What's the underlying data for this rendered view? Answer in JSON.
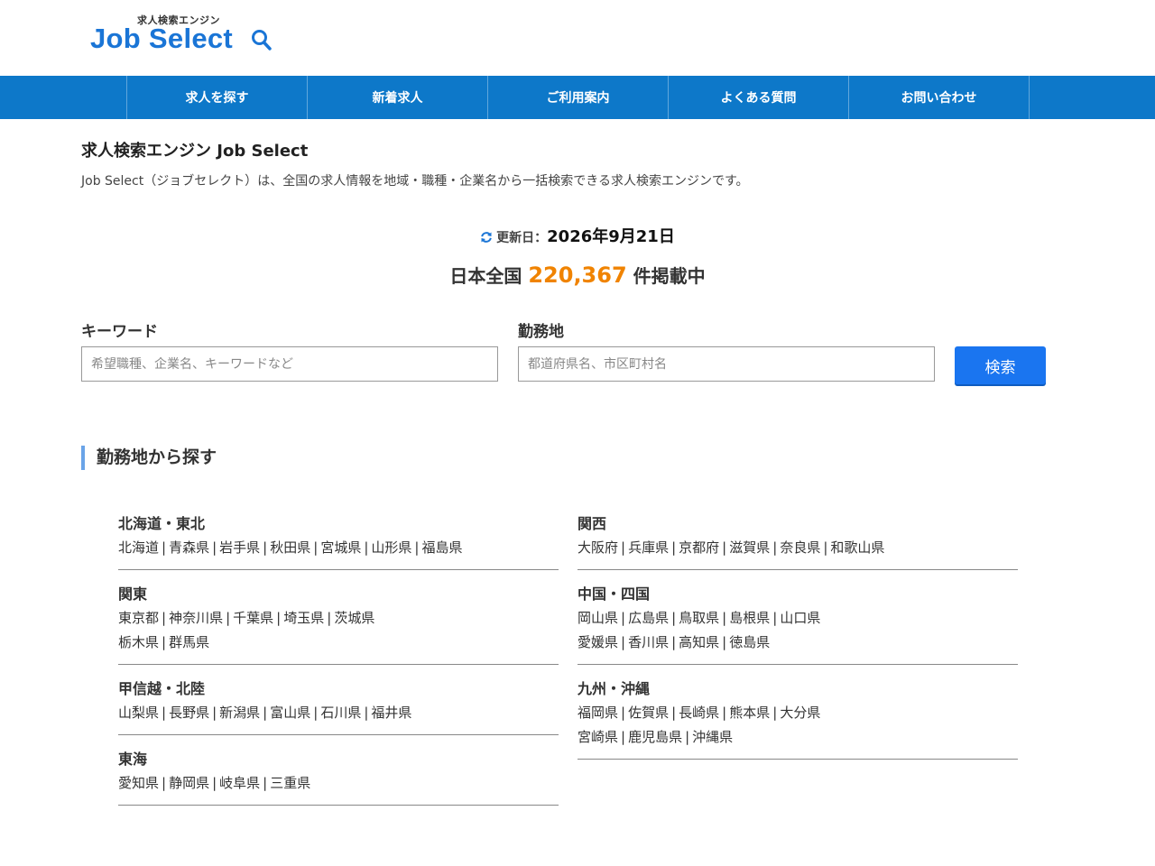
{
  "logo": {
    "subtitle": "求人検索エンジン",
    "name": "Job Select"
  },
  "nav": [
    {
      "label": "求人を探す"
    },
    {
      "label": "新着求人"
    },
    {
      "label": "ご利用案内"
    },
    {
      "label": "よくある質問"
    },
    {
      "label": "お問い合わせ"
    }
  ],
  "site": {
    "title": "求人検索エンジン Job Select",
    "description": "Job Select（ジョブセレクト）は、全国の求人情報を地域・職種・企業名から一括検索できる求人検索エンジンです。"
  },
  "updated": {
    "label": "更新日：",
    "date": "2026年9月21日",
    "icon": "refresh-icon"
  },
  "count": {
    "prefix": "日本全国",
    "number": "220,367",
    "suffix": "件掲載中"
  },
  "search": {
    "keyword_label": "キーワード",
    "keyword_placeholder": "希望職種、企業名、キーワードなど",
    "keyword_value": "",
    "location_label": "勤務地",
    "location_placeholder": "都道府県名、市区町村名",
    "location_value": "",
    "button_label": "検索"
  },
  "section": {
    "title": "勤務地から探す"
  },
  "regions_left": [
    {
      "name": "北海道・東北",
      "lines": [
        [
          "北海道",
          "青森県",
          "岩手県",
          "秋田県",
          "宮城県",
          "山形県",
          "福島県"
        ]
      ]
    },
    {
      "name": "関東",
      "lines": [
        [
          "東京都",
          "神奈川県",
          "千葉県",
          "埼玉県",
          "茨城県"
        ],
        [
          "栃木県",
          "群馬県"
        ]
      ]
    },
    {
      "name": "甲信越・北陸",
      "lines": [
        [
          "山梨県",
          "長野県",
          "新潟県",
          "富山県",
          "石川県",
          "福井県"
        ]
      ]
    },
    {
      "name": "東海",
      "lines": [
        [
          "愛知県",
          "静岡県",
          "岐阜県",
          "三重県"
        ]
      ]
    }
  ],
  "regions_right": [
    {
      "name": "関西",
      "lines": [
        [
          "大阪府",
          "兵庫県",
          "京都府",
          "滋賀県",
          "奈良県",
          "和歌山県"
        ]
      ]
    },
    {
      "name": "中国・四国",
      "lines": [
        [
          "岡山県",
          "広島県",
          "鳥取県",
          "島根県",
          "山口県"
        ],
        [
          "愛媛県",
          "香川県",
          "高知県",
          "徳島県"
        ]
      ]
    },
    {
      "name": "九州・沖縄",
      "lines": [
        [
          "福岡県",
          "佐賀県",
          "長崎県",
          "熊本県",
          "大分県"
        ],
        [
          "宮崎県",
          "鹿児島県",
          "沖縄県"
        ]
      ]
    }
  ],
  "colors": {
    "brand": "#1a75d6",
    "nav": "#0d78c9",
    "accent": "#f08300",
    "button": "#1a75f0"
  }
}
